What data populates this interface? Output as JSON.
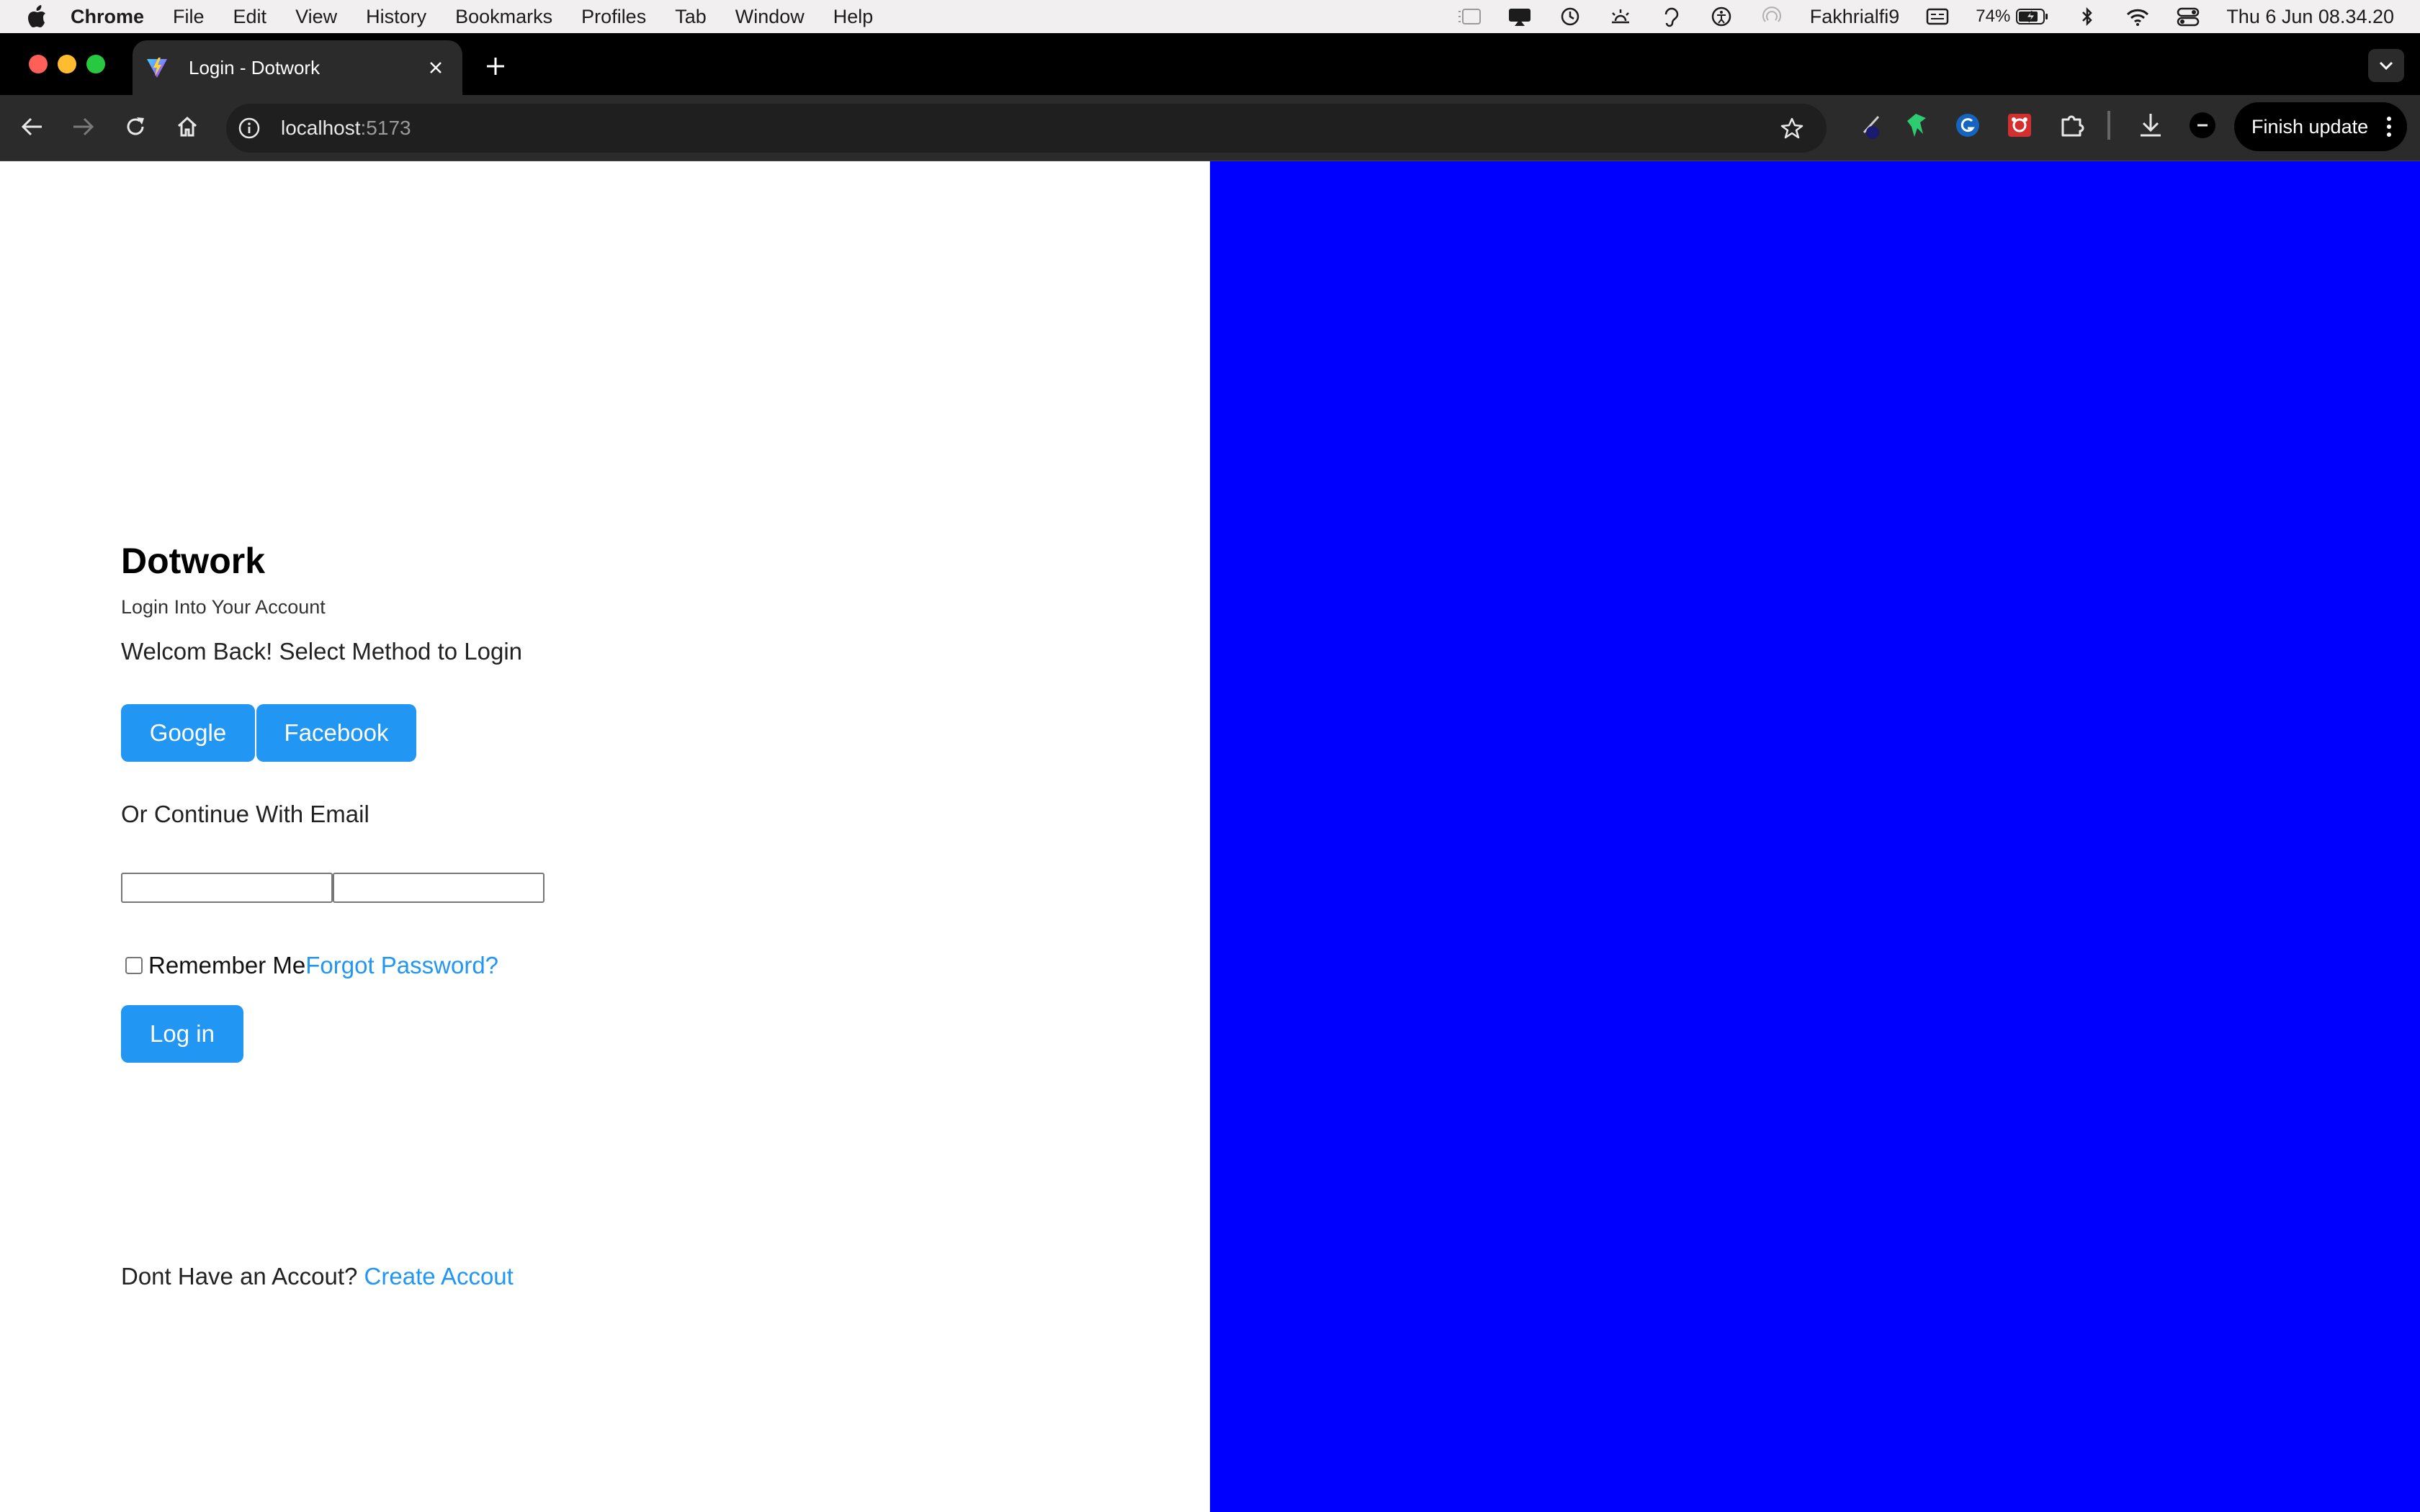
{
  "menubar": {
    "app_name": "Chrome",
    "items": [
      "File",
      "Edit",
      "View",
      "History",
      "Bookmarks",
      "Profiles",
      "Tab",
      "Window",
      "Help"
    ],
    "user": "Fakhrialfi9",
    "battery": "74%",
    "datetime": "Thu 6 Jun  08.34.20"
  },
  "tab": {
    "title": "Login - Dotwork"
  },
  "toolbar": {
    "url_host": "localhost",
    "url_port": ":5173",
    "finish_update": "Finish update"
  },
  "login": {
    "brand": "Dotwork",
    "subtitle": "Login Into Your Account",
    "welcome": "Welcom Back! Select Method to Login",
    "google_button": "Google",
    "facebook_button": "Facebook",
    "or_continue": "Or Continue With Email",
    "email_value": "",
    "password_value": "",
    "remember_me": "Remember Me",
    "forgot_password": "Forgot Password?",
    "login_button": "Log in",
    "no_account": "Dont Have an Accout? ",
    "create_account": "Create Accout"
  },
  "colors": {
    "accent": "#2196f3",
    "right_panel": "#0000ff",
    "tab_strip": "#000000",
    "toolbar": "#2b2b2b"
  }
}
